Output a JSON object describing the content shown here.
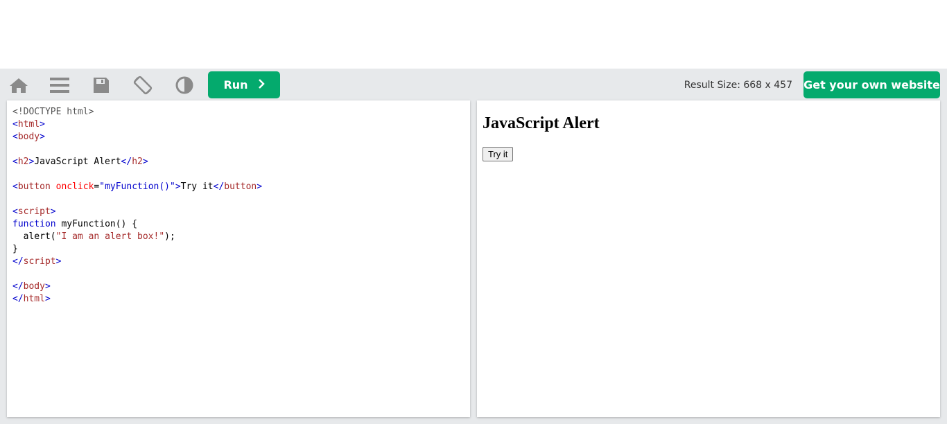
{
  "toolbar": {
    "run_label": "Run",
    "result_size": "Result Size: 668 x 457",
    "get_website_label": "Get your own website",
    "icons": [
      "home-icon",
      "menu-icon",
      "save-icon",
      "rotate-icon",
      "contrast-icon",
      "chevron-right-icon"
    ]
  },
  "editor": {
    "lines": [
      [
        {
          "c": "doc",
          "t": "<!DOCTYPE html>"
        }
      ],
      [
        {
          "c": "br",
          "t": "<"
        },
        {
          "c": "tag",
          "t": "html"
        },
        {
          "c": "br",
          "t": ">"
        }
      ],
      [
        {
          "c": "br",
          "t": "<"
        },
        {
          "c": "tag",
          "t": "body"
        },
        {
          "c": "br",
          "t": ">"
        }
      ],
      [],
      [
        {
          "c": "br",
          "t": "<"
        },
        {
          "c": "tag",
          "t": "h2"
        },
        {
          "c": "br",
          "t": ">"
        },
        {
          "c": "txt",
          "t": "JavaScript Alert"
        },
        {
          "c": "br",
          "t": "</"
        },
        {
          "c": "tag",
          "t": "h2"
        },
        {
          "c": "br",
          "t": ">"
        }
      ],
      [],
      [
        {
          "c": "br",
          "t": "<"
        },
        {
          "c": "tag",
          "t": "button"
        },
        {
          "c": "txt",
          "t": " "
        },
        {
          "c": "attr",
          "t": "onclick"
        },
        {
          "c": "txt",
          "t": "="
        },
        {
          "c": "val",
          "t": "\"myFunction()\""
        },
        {
          "c": "br",
          "t": ">"
        },
        {
          "c": "txt",
          "t": "Try it"
        },
        {
          "c": "br",
          "t": "</"
        },
        {
          "c": "tag",
          "t": "button"
        },
        {
          "c": "br",
          "t": ">"
        }
      ],
      [],
      [
        {
          "c": "br",
          "t": "<"
        },
        {
          "c": "tag",
          "t": "script"
        },
        {
          "c": "br",
          "t": ">"
        }
      ],
      [
        {
          "c": "kw",
          "t": "function"
        },
        {
          "c": "txt",
          "t": " myFunction() {"
        }
      ],
      [
        {
          "c": "txt",
          "t": "  alert("
        },
        {
          "c": "str",
          "t": "\"I am an alert box!\""
        },
        {
          "c": "txt",
          "t": ");"
        }
      ],
      [
        {
          "c": "txt",
          "t": "}"
        }
      ],
      [
        {
          "c": "br",
          "t": "</"
        },
        {
          "c": "tag",
          "t": "script"
        },
        {
          "c": "br",
          "t": ">"
        }
      ],
      [],
      [
        {
          "c": "br",
          "t": "</"
        },
        {
          "c": "tag",
          "t": "body"
        },
        {
          "c": "br",
          "t": ">"
        }
      ],
      [
        {
          "c": "br",
          "t": "</"
        },
        {
          "c": "tag",
          "t": "html"
        },
        {
          "c": "br",
          "t": ">"
        }
      ]
    ]
  },
  "result": {
    "heading": "JavaScript Alert",
    "button_label": "Try it"
  },
  "colors": {
    "accent": "#04aa6d",
    "toolbar_bg": "#e7e9eb",
    "icon_gray": "#8a8a8a"
  }
}
